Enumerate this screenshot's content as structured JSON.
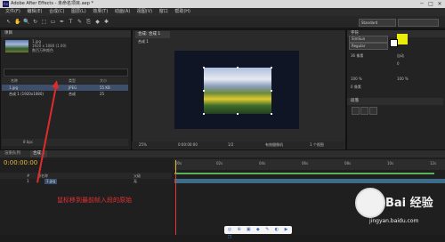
{
  "window": {
    "app_badge": "Ae",
    "title": "Adobe After Effects - 未命名项目.aep *",
    "controls": [
      "─",
      "□",
      "✕"
    ]
  },
  "menu": [
    "文件(F)",
    "编辑(E)",
    "合成(C)",
    "图层(L)",
    "效果(T)",
    "动画(A)",
    "视图(V)",
    "窗口",
    "帮助(H)"
  ],
  "toolbar": {
    "workspace": "Standard",
    "tools": [
      "↖",
      "✋",
      "🔍",
      "↻",
      "⬚",
      "▭",
      "✒",
      "T",
      "✎",
      "⎘",
      "◆",
      "✱"
    ]
  },
  "project_panel": {
    "tab": "项目",
    "item_name": "1.jpg",
    "item_info_1": "1920 x 1080 (1.00)",
    "item_info_2": "数百万种颜色",
    "columns": [
      "名称",
      "类型",
      "大小"
    ],
    "rows": [
      {
        "name": "1.jpg",
        "type": "JPEG",
        "size": "55 KB"
      },
      {
        "name": "合成 1 (1920x1080)",
        "type": "合成",
        "size": "25"
      }
    ],
    "footer": "8 bpc"
  },
  "composition_panel": {
    "tab": "合成: 合成 1",
    "subtab": "合成 1",
    "zoom": "25%",
    "timecode": "0:00:00:00",
    "resolution": "1/2",
    "camera": "有效摄像机",
    "view": "1 个视图"
  },
  "character_panel": {
    "tab": "字符",
    "font": "SimSun",
    "style": "Regular",
    "size": "36 像素",
    "leading": "自动",
    "tracking": "0",
    "vert_scale": "100 %",
    "horz_scale": "100 %",
    "baseline": "0 像素",
    "para_tab": "段落"
  },
  "timeline": {
    "tabs": [
      "渲染队列",
      "合成 1"
    ],
    "timecode": "0:00:00:00",
    "ruler_labels": [
      "00s",
      "02s",
      "04s",
      "06s",
      "08s",
      "10s",
      "12s"
    ],
    "header_cols": [
      "#",
      "源名称",
      "父级"
    ],
    "layer_index": "1",
    "layer_name": "1.jpg",
    "layer_parent": "无"
  },
  "annotation": "鼠标移到最前帧入段的原始",
  "watermark": {
    "brand": "Bai 经验",
    "url": "jingyan.baidu.com"
  },
  "bottom_bar_icons": [
    "◎",
    "⊕",
    "▣",
    "◆",
    "✎",
    "◐",
    "▶",
    "❐",
    "⊞"
  ],
  "colors": {
    "accent": "#e6b93a",
    "annotation": "#e02b2b",
    "fill_swatch": "#ecec0c"
  }
}
